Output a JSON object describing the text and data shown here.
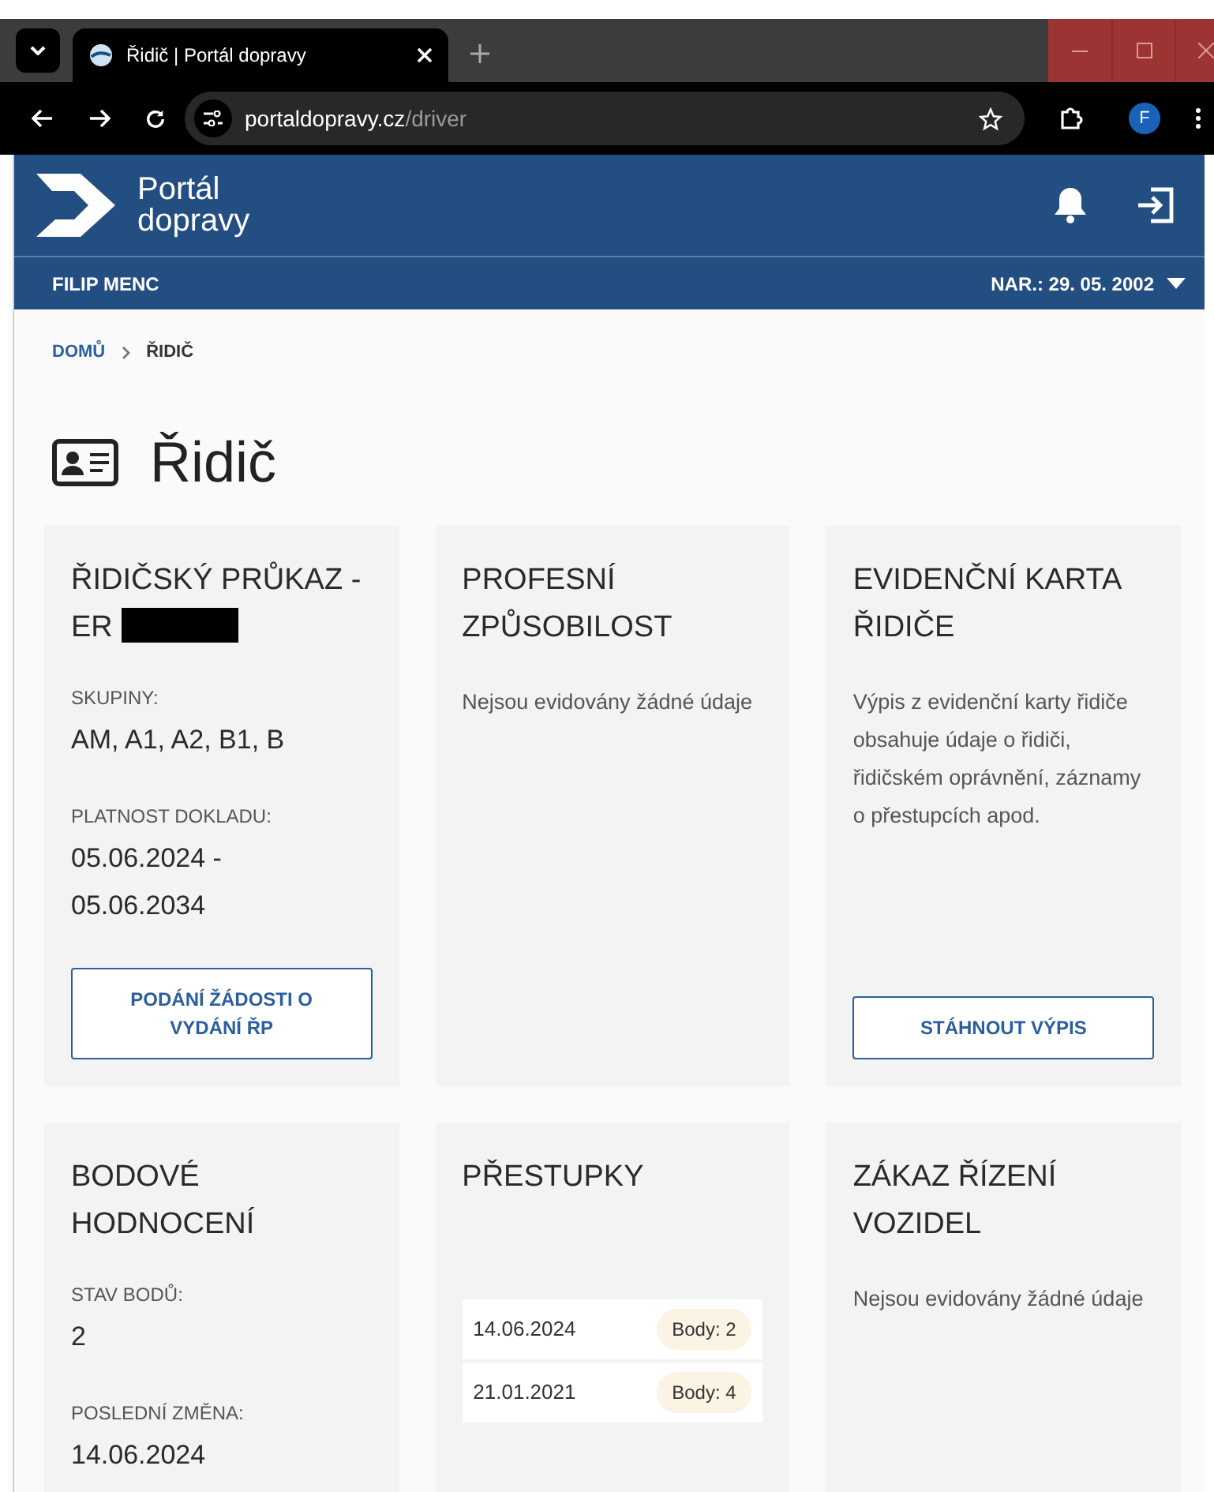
{
  "browser": {
    "tab_title": "Řidič | Portál dopravy",
    "url_host": "portaldopravy.cz",
    "url_path": "/driver",
    "profile_initial": "F"
  },
  "header": {
    "logo_line1": "Portál",
    "logo_line2": "dopravy",
    "user_name": "FILIP MENC",
    "birth_date": "NAR.: 29. 05. 2002"
  },
  "breadcrumb": [
    {
      "label": "DOMŮ",
      "current": false
    },
    {
      "label": "ŘIDIČ",
      "current": true
    }
  ],
  "page_title": "Řidič",
  "cards": [
    {
      "title": "ŘIDIČSKÝ PRŮKAZ - ER",
      "redacted": true,
      "blocks": [
        {
          "kind": "field",
          "label": "SKUPINY:",
          "value": "AM, A1, A2, B1, B"
        },
        {
          "kind": "field",
          "label": "PLATNOST DOKLADU:",
          "value": "05.06.2024 - 05.06.2034"
        },
        {
          "kind": "button",
          "label": "PODÁNÍ ŽÁDOSTI O VYDÁNÍ ŘP"
        }
      ]
    },
    {
      "title": "PROFESNÍ ZPŮSOBILOST",
      "redacted": false,
      "blocks": [
        {
          "kind": "paragraph",
          "text": "Nejsou evidovány žádné údaje"
        }
      ]
    },
    {
      "title": "EVIDENČNÍ KARTA ŘIDIČE",
      "redacted": false,
      "blocks": [
        {
          "kind": "paragraph",
          "text": "Výpis z evidenční karty řidiče obsahuje údaje o řidiči, řidičském oprávnění, záznamy o přestupcích apod."
        },
        {
          "kind": "button",
          "label": "STÁHNOUT VÝPIS"
        }
      ]
    },
    {
      "title": "BODOVÉ HODNOCENÍ",
      "redacted": false,
      "blocks": [
        {
          "kind": "field",
          "label": "STAV BODŮ:",
          "value": "2"
        },
        {
          "kind": "field",
          "label": "POSLEDNÍ ZMĚNA:",
          "value": "14.06.2024"
        }
      ]
    },
    {
      "title": "PŘESTUPKY",
      "redacted": false,
      "blocks": [
        {
          "kind": "list",
          "items": [
            {
              "date": "14.06.2024",
              "points": "Body: 2"
            },
            {
              "date": "21.01.2021",
              "points": "Body: 4"
            }
          ]
        }
      ]
    },
    {
      "title": "ZÁKAZ ŘÍZENÍ VOZIDEL",
      "redacted": false,
      "blocks": [
        {
          "kind": "paragraph",
          "text": "Nejsou evidovány žádné údaje"
        }
      ]
    }
  ]
}
